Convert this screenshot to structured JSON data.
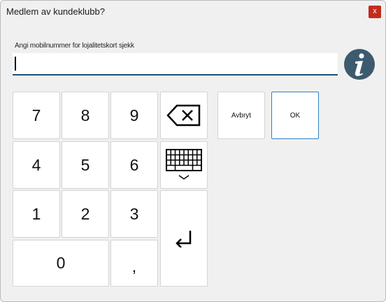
{
  "window": {
    "title": "Medlem av kundeklubb?",
    "close_label": "x"
  },
  "prompt": {
    "label": "Angi mobilnummer for lojalitetskort sjekk",
    "value": ""
  },
  "keypad": {
    "k7": "7",
    "k8": "8",
    "k9": "9",
    "k4": "4",
    "k5": "5",
    "k6": "6",
    "k1": "1",
    "k2": "2",
    "k3": "3",
    "k0": "0",
    "comma": ","
  },
  "actions": {
    "cancel_label": "Avbryt",
    "ok_label": "OK"
  },
  "icons": {
    "info": "info-icon",
    "backspace": "backspace-icon",
    "keyboard": "keyboard-icon",
    "enter": "enter-icon"
  },
  "colors": {
    "close": "#c42b1c",
    "accent": "#1f4e79",
    "ok_border": "#2f7fc1",
    "info": "#3d5a6e"
  }
}
